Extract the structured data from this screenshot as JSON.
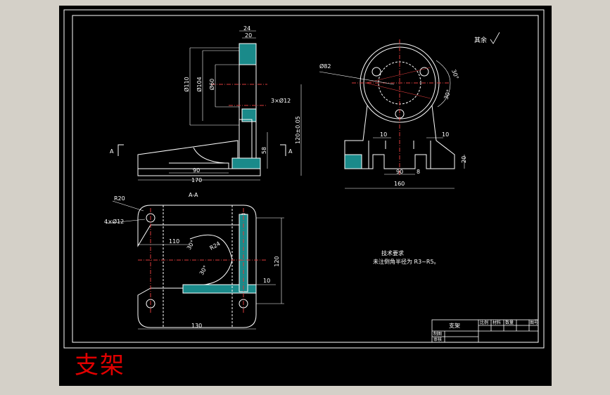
{
  "drawing": {
    "title": "支架",
    "rough_note": "其余",
    "tech_requirements_title": "技术要求",
    "tech_requirements_text": "未注倒角半径为 R3~R5。",
    "section_label": "A-A",
    "section_mark": "A",
    "title_block": {
      "part_name": "支架",
      "headers": [
        "比例",
        "材料",
        "数量",
        "图号"
      ],
      "row_labels": [
        "制图",
        "审核"
      ]
    }
  },
  "dimensions": {
    "front_view": [
      "24",
      "20",
      "Ø110",
      "Ø104",
      "Ø60",
      "3×Ø12",
      "120±0.05",
      "58",
      "90",
      "170"
    ],
    "side_view": [
      "Ø82",
      "30°",
      "30°",
      "10",
      "10",
      "20",
      "90",
      "8",
      "160"
    ],
    "top_view": [
      "R20",
      "4×Ø12",
      "110",
      "30°",
      "R24",
      "30°",
      "120",
      "10",
      "130"
    ]
  }
}
